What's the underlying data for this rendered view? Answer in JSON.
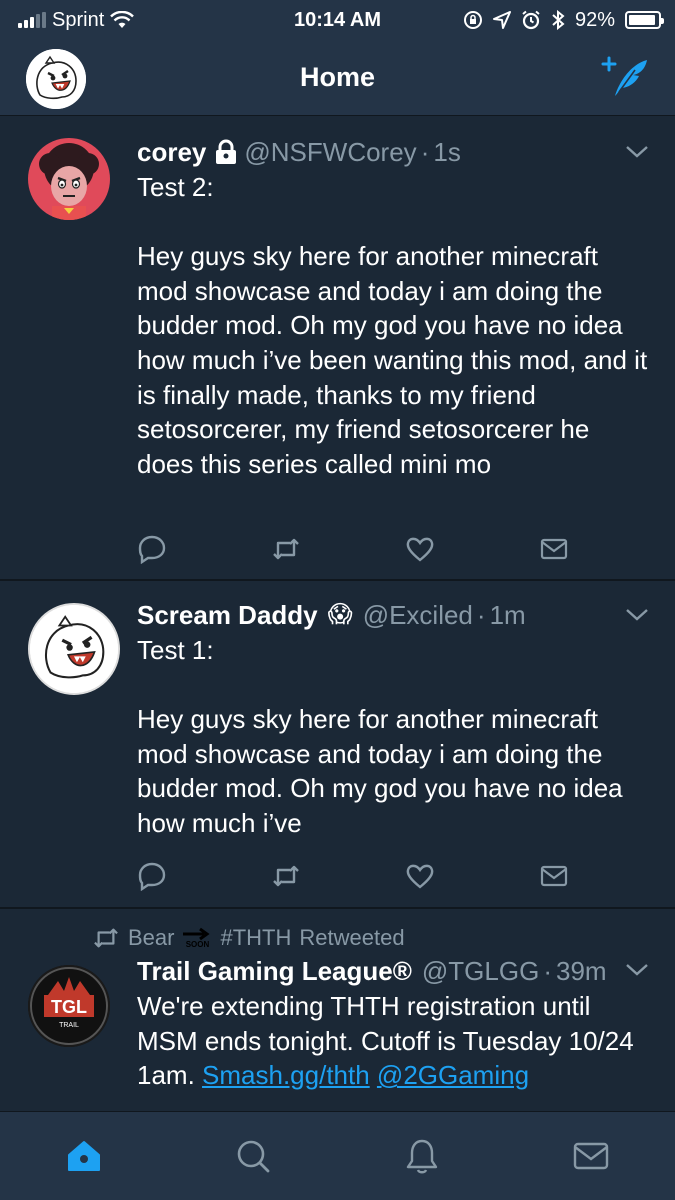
{
  "status_bar": {
    "carrier": "Sprint",
    "time": "10:14 AM",
    "battery": "92%",
    "battery_level": 0.92
  },
  "nav": {
    "title": "Home"
  },
  "tweets": [
    {
      "name": "corey",
      "handle": "@NSFWCorey",
      "time": "1s",
      "protected": true,
      "text": "Test 2:\n\nHey guys sky here for another minecraft mod showcase and today i am doing the budder mod. Oh my god you have no idea how much i’ve been wanting this mod, and it is finally made, thanks to my friend setosorcerer, my friend setosorcerer he does this series called mini mo"
    },
    {
      "name": "Scream Daddy",
      "emoji": "😱",
      "handle": "@Exciled",
      "time": "1m",
      "text": "Test 1:\n\nHey guys sky here for another minecraft mod showcase and today i am doing the budder mod. Oh my god you have no idea how much i’ve"
    },
    {
      "retweeted_by": "Bear",
      "retweeted_hashtag": "#THTH",
      "retweeted_label": "Retweeted",
      "name": "Trail Gaming League®",
      "handle": "@TGLGG",
      "time": "39m",
      "text": "We're extending THTH registration until MSM ends tonight. Cutoff is Tuesday 10/24 1am. ",
      "link": "Smash.gg/thth",
      "mention": "@2GGaming",
      "logo_text": "TGL",
      "logo_subtext": "TRAIL"
    }
  ],
  "soon_label": "SOON",
  "tabs": [
    "home",
    "search",
    "notifications",
    "messages"
  ],
  "colors": {
    "background": "#141d26",
    "card": "#1b2836",
    "bar": "#243447",
    "accent": "#1da1f2",
    "secondary_text": "#8899a6"
  }
}
